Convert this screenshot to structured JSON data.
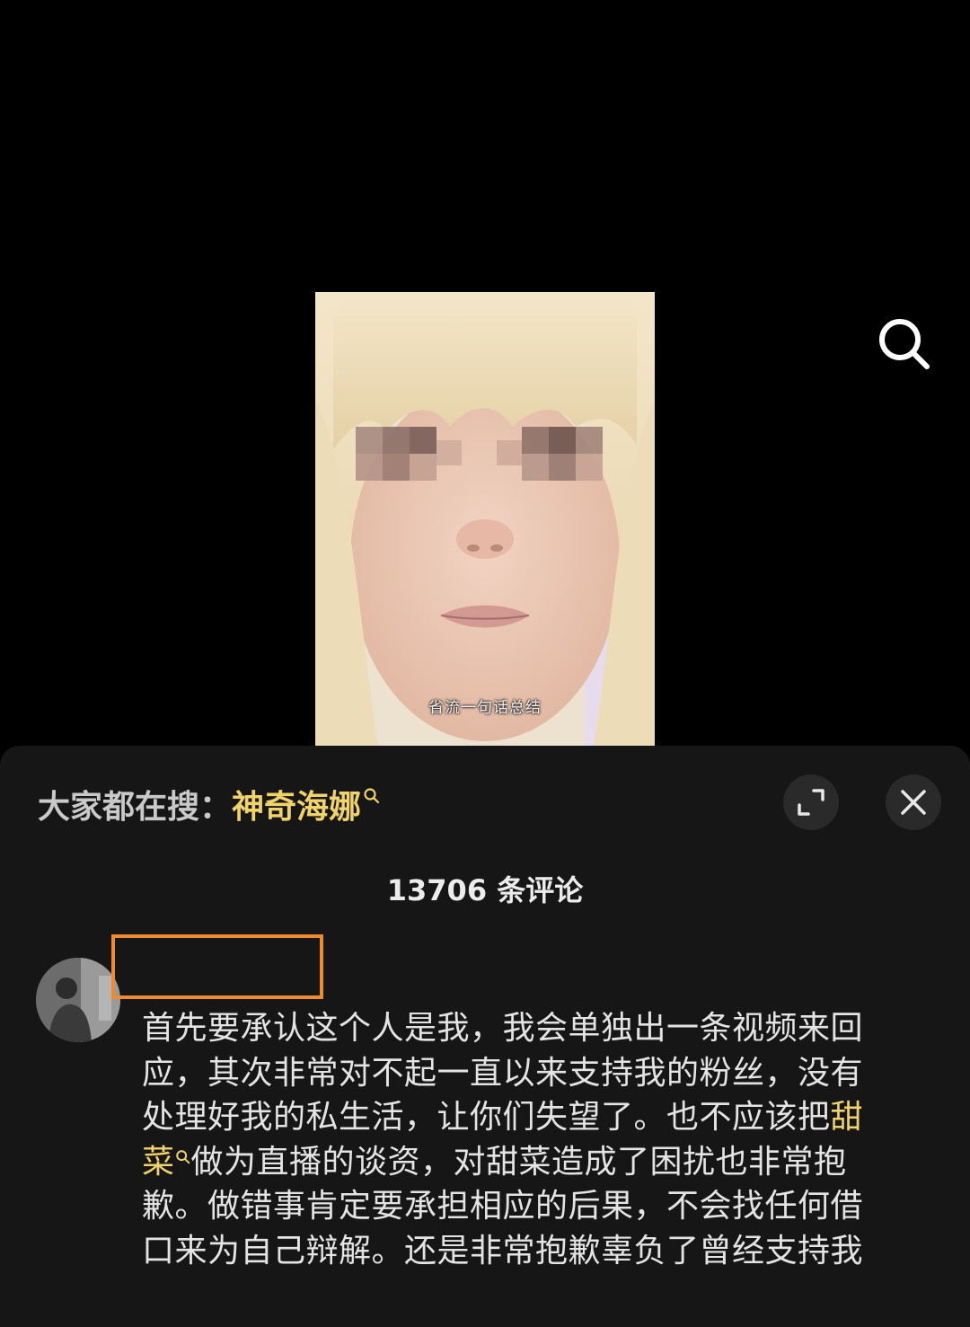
{
  "video": {
    "caption": "省流一句话总结"
  },
  "sheet": {
    "trend_prefix": "大家都在搜：",
    "trend_term": "神奇海娜",
    "comment_count": "13706 条评论"
  },
  "comment": {
    "line1": "首先要承认这个人是我，我会单独出一条视频来回",
    "line2": "应，其次非常对不起一直以来支持我的粉丝，没有",
    "line3_text": "处理好我的私生活，让你们失望了。也不应该把",
    "line3_highlight": "甜",
    "line4_highlight": "菜",
    "line4_text": "做为直播的谈资，对甜菜造成了困扰也非常抱",
    "line5": "歉。做错事肯定要承担相应的后果，不会找任何借",
    "line6": "口来为自己辩解。还是非常抱歉辜负了曾经支持我"
  },
  "colors": {
    "background": "#000000",
    "sheet": "#161616",
    "highlight": "#f1d36b",
    "redact_box": "#ef8a2e"
  },
  "icons": {
    "search": "search-icon",
    "expand": "expand-icon",
    "close": "close-icon",
    "trend_search": "small-search-icon"
  }
}
